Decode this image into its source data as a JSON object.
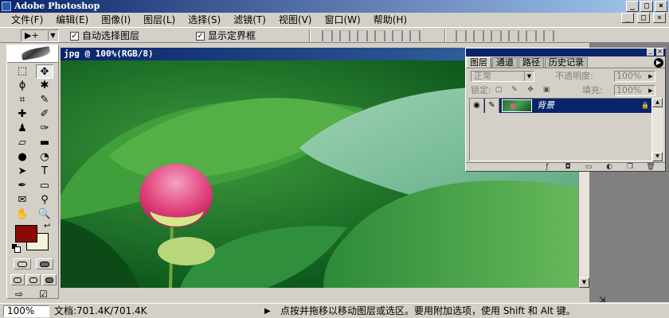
{
  "app": {
    "title": "Adobe Photoshop"
  },
  "window_buttons": {
    "minimize": "_",
    "maximize": "□",
    "close": "×"
  },
  "menu": {
    "items": [
      "文件(F)",
      "编辑(E)",
      "图像(I)",
      "图层(L)",
      "选择(S)",
      "滤镜(T)",
      "视图(V)",
      "窗口(W)",
      "帮助(H)"
    ]
  },
  "options": {
    "tool_glyph": "▶+",
    "auto_select": {
      "label": "自动选择图层",
      "checked": true
    },
    "show_bounds": {
      "label": "显示定界框",
      "checked": true
    }
  },
  "toolbox": {
    "colors": {
      "foreground": "#8b0a05",
      "background": "#f5f2dc"
    },
    "tools": [
      {
        "name": "marquee-icon",
        "glyph": "⬚"
      },
      {
        "name": "move-icon",
        "glyph": "✥"
      },
      {
        "name": "lasso-icon",
        "glyph": "ϕ"
      },
      {
        "name": "magic-wand-icon",
        "glyph": "✱"
      },
      {
        "name": "crop-icon",
        "glyph": "⌗"
      },
      {
        "name": "slice-icon",
        "glyph": "✎"
      },
      {
        "name": "healing-brush-icon",
        "glyph": "✚"
      },
      {
        "name": "brush-icon",
        "glyph": "✐"
      },
      {
        "name": "clone-stamp-icon",
        "glyph": "♟"
      },
      {
        "name": "history-brush-icon",
        "glyph": "✑"
      },
      {
        "name": "eraser-icon",
        "glyph": "▱"
      },
      {
        "name": "gradient-icon",
        "glyph": "▬"
      },
      {
        "name": "blur-icon",
        "glyph": "●"
      },
      {
        "name": "dodge-icon",
        "glyph": "◔"
      },
      {
        "name": "path-select-icon",
        "glyph": "➤"
      },
      {
        "name": "type-icon",
        "glyph": "T"
      },
      {
        "name": "pen-icon",
        "glyph": "✒"
      },
      {
        "name": "shape-icon",
        "glyph": "▭"
      },
      {
        "name": "notes-icon",
        "glyph": "✉"
      },
      {
        "name": "eyedropper-icon",
        "glyph": "⚲"
      },
      {
        "name": "hand-icon",
        "glyph": "✋"
      },
      {
        "name": "zoom-icon",
        "glyph": "🔍"
      }
    ]
  },
  "document": {
    "title": "jpg @ 100%(RGB/8)",
    "scroll_up": "▲",
    "scroll_down": "▼"
  },
  "layers_panel": {
    "tabs": [
      "图层",
      "通道",
      "路径",
      "历史记录"
    ],
    "active_tab": 0,
    "blend_mode": "正常",
    "opacity_label": "不透明度:",
    "opacity_value": "100%",
    "lock_label": "锁定:",
    "fill_label": "填充:",
    "fill_value": "100%",
    "layer": {
      "name": "背景"
    },
    "footer_icons": [
      "layer-style-icon",
      "mask-icon",
      "new-set-icon",
      "adjustment-icon",
      "new-layer-icon",
      "trash-icon"
    ]
  },
  "status": {
    "zoom": "100%",
    "doc_size": "文档:701.4K/701.4K",
    "arrow": "▶",
    "hint": "点按并拖移以移动图层或选区。要用附加选项，使用 Shift 和 Alt 键。"
  }
}
